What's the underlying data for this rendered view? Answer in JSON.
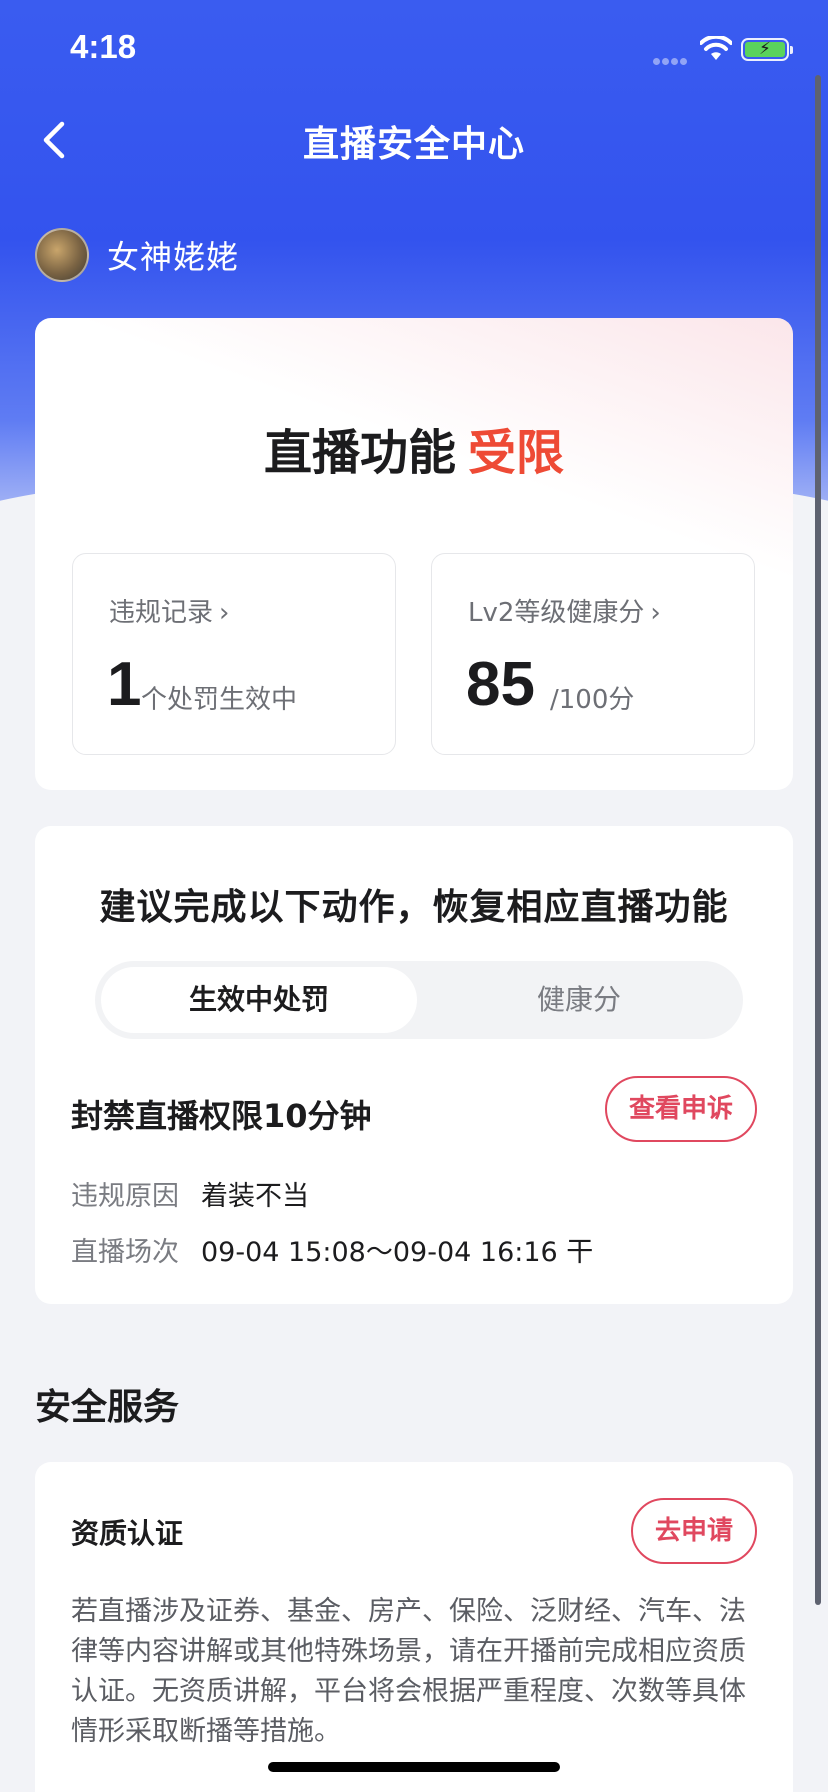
{
  "status_bar": {
    "time": "4:18"
  },
  "nav": {
    "title": "直播安全中心"
  },
  "user": {
    "name": "女神姥姥"
  },
  "status": {
    "headline_prefix": "直播功能",
    "headline_state": "受限",
    "violations": {
      "label": "违规记录",
      "count": "1",
      "unit": "个处罚生效中"
    },
    "health": {
      "label": "Lv2等级健康分",
      "score": "85",
      "max": "/100分"
    }
  },
  "actions": {
    "title": "建议完成以下动作，恢复相应直播功能",
    "tabs": [
      {
        "label": "生效中处罚",
        "active": true
      },
      {
        "label": "健康分",
        "active": false
      }
    ],
    "penalty": {
      "title": "封禁直播权限10分钟",
      "appeal_label": "查看申诉",
      "reason_key": "违规原因",
      "reason_value": "着装不当",
      "session_key": "直播场次",
      "session_value": "09-04 15:08～09-04 16:16 干"
    }
  },
  "services": {
    "section_title": "安全服务",
    "items": [
      {
        "title": "资质认证",
        "button_label": "去申请",
        "description": "若直播涉及证券、基金、房产、保险、泛财经、汽车、法律等内容讲解或其他特殊场景，请在开播前完成相应资质认证。无资质讲解，平台将会根据严重程度、次数等具体情形采取断播等措施。"
      }
    ]
  },
  "colors": {
    "brand_blue": "#3353ee",
    "restricted_red": "#ee4a35",
    "button_red": "#e0485f"
  }
}
